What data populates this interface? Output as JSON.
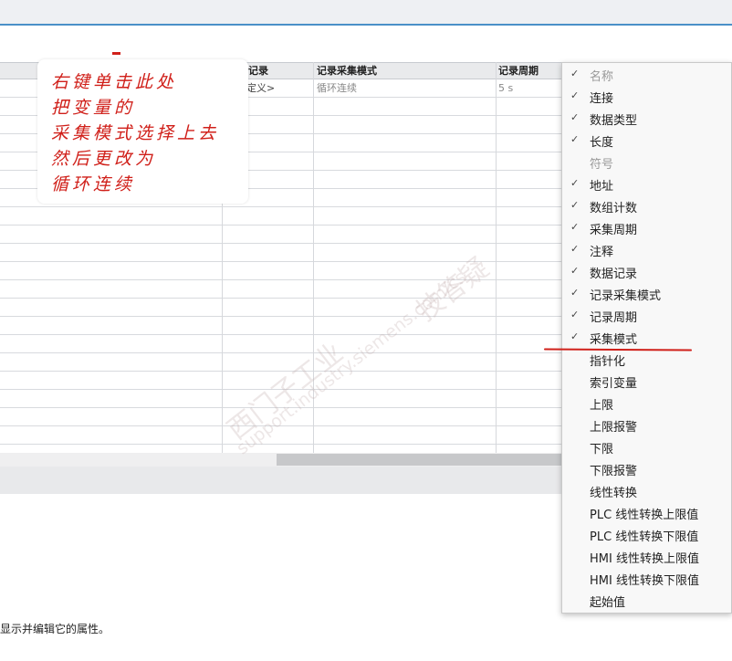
{
  "table": {
    "columns": [
      "记录",
      "记录采集模式",
      "记录周期"
    ],
    "first_row": [
      "定义>",
      "循环连续",
      "5 s"
    ]
  },
  "annotation": {
    "lines": [
      "右键单击此处",
      "把变量的",
      "采集模式选择上去",
      "然后更改为",
      "循环连续"
    ]
  },
  "context_menu": {
    "items": [
      {
        "label": "名称",
        "checked": true,
        "disabled": true
      },
      {
        "label": "连接",
        "checked": true,
        "disabled": false
      },
      {
        "label": "数据类型",
        "checked": true,
        "disabled": false
      },
      {
        "label": "长度",
        "checked": true,
        "disabled": false
      },
      {
        "label": "符号",
        "checked": false,
        "disabled": true
      },
      {
        "label": "地址",
        "checked": true,
        "disabled": false
      },
      {
        "label": "数组计数",
        "checked": true,
        "disabled": false
      },
      {
        "label": "采集周期",
        "checked": true,
        "disabled": false
      },
      {
        "label": "注释",
        "checked": true,
        "disabled": false
      },
      {
        "label": "数据记录",
        "checked": true,
        "disabled": false
      },
      {
        "label": "记录采集模式",
        "checked": true,
        "disabled": false
      },
      {
        "label": "记录周期",
        "checked": true,
        "disabled": false
      },
      {
        "label": "采集模式",
        "checked": true,
        "disabled": false
      },
      {
        "label": "指针化",
        "checked": false,
        "disabled": false
      },
      {
        "label": "索引变量",
        "checked": false,
        "disabled": false
      },
      {
        "label": "上限",
        "checked": false,
        "disabled": false
      },
      {
        "label": "上限报警",
        "checked": false,
        "disabled": false
      },
      {
        "label": "下限",
        "checked": false,
        "disabled": false
      },
      {
        "label": "下限报警",
        "checked": false,
        "disabled": false
      },
      {
        "label": "线性转换",
        "checked": false,
        "disabled": false
      },
      {
        "label": "PLC 线性转换上限值",
        "checked": false,
        "disabled": false
      },
      {
        "label": "PLC 线性转换下限值",
        "checked": false,
        "disabled": false
      },
      {
        "label": "HMI 线性转换上限值",
        "checked": false,
        "disabled": false
      },
      {
        "label": "HMI 线性转换下限值",
        "checked": false,
        "disabled": false
      },
      {
        "label": "起始值",
        "checked": false,
        "disabled": false
      }
    ],
    "check_glyph": "✓"
  },
  "status": {
    "text": "显示并编辑它的属性。"
  },
  "watermark": {
    "line1": "西门子工业",
    "line2": "技答疑",
    "line3": "support.industry.siemens.com/cs"
  }
}
